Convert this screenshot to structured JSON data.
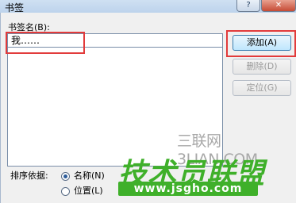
{
  "window": {
    "title": "书签",
    "help_label": "?",
    "close_label": "✕"
  },
  "form": {
    "name_label": "书签名(B):",
    "name_value": "我……",
    "sort_label": "排序依据:"
  },
  "buttons": {
    "add": "添加(A)",
    "delete": "删除(D)",
    "locate": "定位(G)"
  },
  "sort_options": [
    {
      "label": "名称(N)",
      "checked": true
    },
    {
      "label": "位置(L)",
      "checked": false
    }
  ],
  "watermark": {
    "line1": "三联网 3LIAN.COM",
    "line2": "技术员联盟",
    "line3": "www.jsgho.com"
  },
  "colors": {
    "highlight": "#e23b3b",
    "watermark_green": "#3fb02a"
  }
}
